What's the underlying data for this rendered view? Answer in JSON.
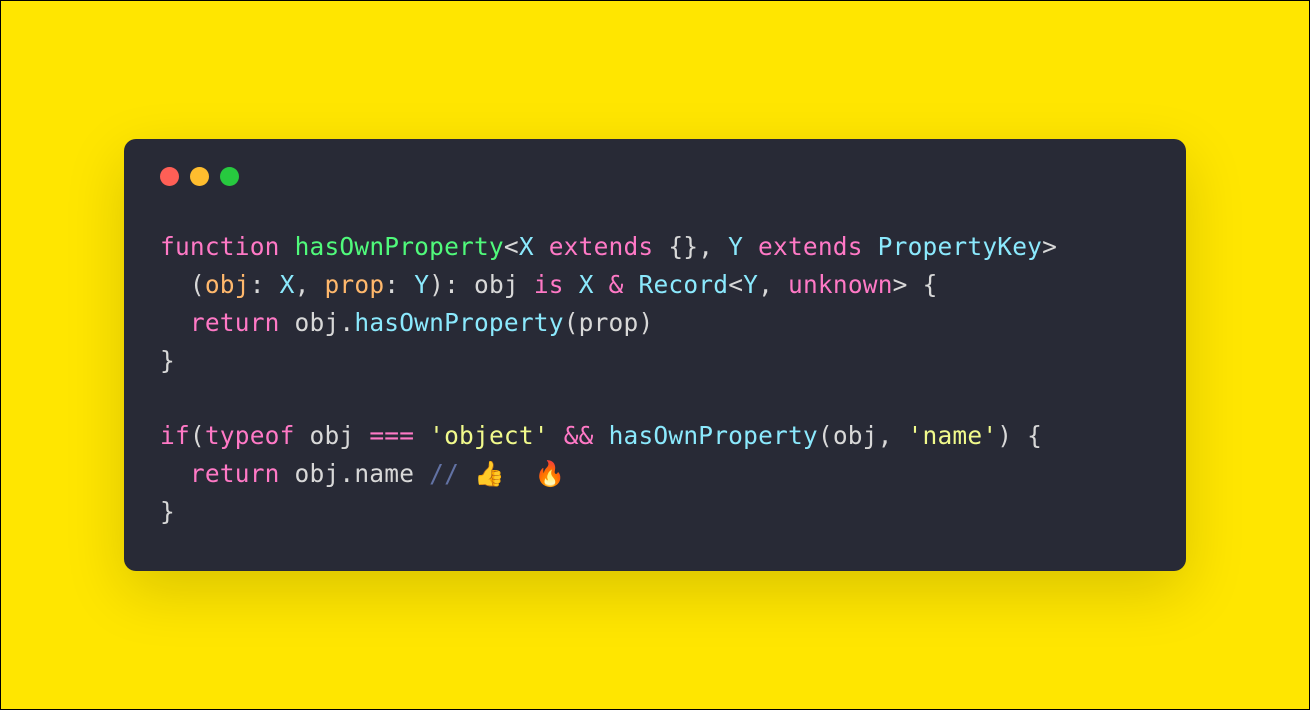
{
  "window": {
    "controls": [
      "red",
      "yellow",
      "green"
    ]
  },
  "colors": {
    "background": "#ffe600",
    "panel": "#282a36",
    "keyword": "#ff79c6",
    "funcname": "#50fa7b",
    "type": "#8be9fd",
    "param": "#ffb86c",
    "string": "#f1fa8c",
    "comment": "#6272a4",
    "plain": "#d8d8d8"
  },
  "code": {
    "lines": [
      [
        {
          "t": "function ",
          "c": "keyword"
        },
        {
          "t": "hasOwnProperty",
          "c": "funcname"
        },
        {
          "t": "<",
          "c": "punct"
        },
        {
          "t": "X",
          "c": "type"
        },
        {
          "t": " extends ",
          "c": "keyword"
        },
        {
          "t": "{}",
          "c": "punct"
        },
        {
          "t": ", ",
          "c": "punct"
        },
        {
          "t": "Y",
          "c": "type"
        },
        {
          "t": " extends ",
          "c": "keyword"
        },
        {
          "t": "PropertyKey",
          "c": "type"
        },
        {
          "t": ">",
          "c": "punct"
        }
      ],
      [
        {
          "t": "  (",
          "c": "punct"
        },
        {
          "t": "obj",
          "c": "param"
        },
        {
          "t": ": ",
          "c": "punct"
        },
        {
          "t": "X",
          "c": "type"
        },
        {
          "t": ", ",
          "c": "punct"
        },
        {
          "t": "prop",
          "c": "param"
        },
        {
          "t": ": ",
          "c": "punct"
        },
        {
          "t": "Y",
          "c": "type"
        },
        {
          "t": "): ",
          "c": "punct"
        },
        {
          "t": "obj",
          "c": "plain"
        },
        {
          "t": " is ",
          "c": "keyword"
        },
        {
          "t": "X",
          "c": "type"
        },
        {
          "t": " & ",
          "c": "operator"
        },
        {
          "t": "Record",
          "c": "type"
        },
        {
          "t": "<",
          "c": "punct"
        },
        {
          "t": "Y",
          "c": "type"
        },
        {
          "t": ", ",
          "c": "punct"
        },
        {
          "t": "unknown",
          "c": "keyword"
        },
        {
          "t": "> {",
          "c": "punct"
        }
      ],
      [
        {
          "t": "  ",
          "c": "plain"
        },
        {
          "t": "return",
          "c": "keyword"
        },
        {
          "t": " obj.",
          "c": "plain"
        },
        {
          "t": "hasOwnProperty",
          "c": "func"
        },
        {
          "t": "(prop)",
          "c": "plain"
        }
      ],
      [
        {
          "t": "}",
          "c": "punct"
        }
      ],
      [
        {
          "t": "",
          "c": "plain"
        }
      ],
      [
        {
          "t": "if",
          "c": "keyword"
        },
        {
          "t": "(",
          "c": "punct"
        },
        {
          "t": "typeof",
          "c": "keyword"
        },
        {
          "t": " obj ",
          "c": "plain"
        },
        {
          "t": "===",
          "c": "operator"
        },
        {
          "t": " ",
          "c": "plain"
        },
        {
          "t": "'object'",
          "c": "string"
        },
        {
          "t": " ",
          "c": "plain"
        },
        {
          "t": "&&",
          "c": "operator"
        },
        {
          "t": " ",
          "c": "plain"
        },
        {
          "t": "hasOwnProperty",
          "c": "func"
        },
        {
          "t": "(obj, ",
          "c": "plain"
        },
        {
          "t": "'name'",
          "c": "string"
        },
        {
          "t": ") {",
          "c": "plain"
        }
      ],
      [
        {
          "t": "  ",
          "c": "plain"
        },
        {
          "t": "return",
          "c": "keyword"
        },
        {
          "t": " obj.name ",
          "c": "plain"
        },
        {
          "t": "// 👍  🔥",
          "c": "comment"
        }
      ],
      [
        {
          "t": "}",
          "c": "punct"
        }
      ]
    ]
  }
}
